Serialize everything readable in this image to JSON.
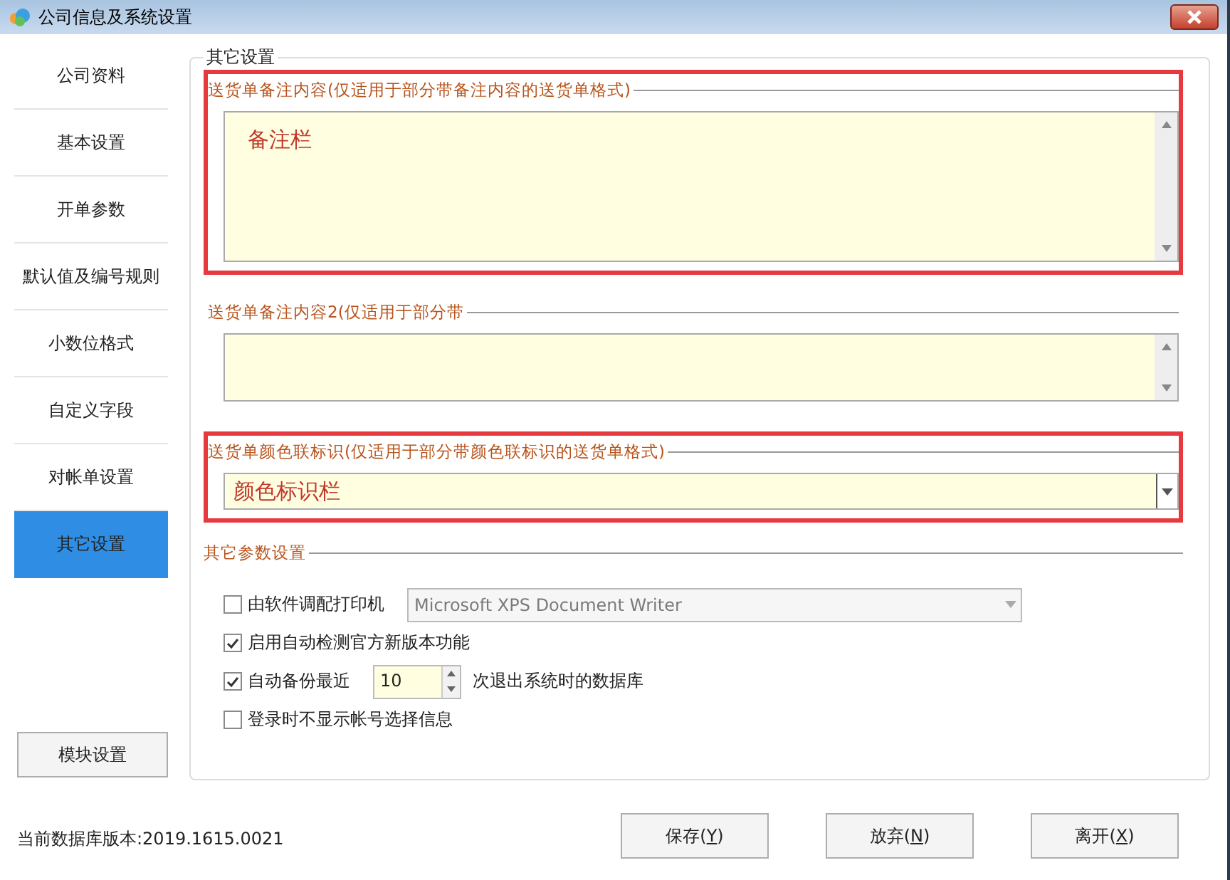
{
  "window": {
    "title": "公司信息及系统设置"
  },
  "sidebar": {
    "items": [
      {
        "label": "公司资料",
        "selected": false
      },
      {
        "label": "基本设置",
        "selected": false
      },
      {
        "label": "开单参数",
        "selected": false
      },
      {
        "label": "默认值及编号规则",
        "selected": false
      },
      {
        "label": "小数位格式",
        "selected": false
      },
      {
        "label": "自定义字段",
        "selected": false
      },
      {
        "label": "对帐单设置",
        "selected": false
      },
      {
        "label": "其它设置",
        "selected": true
      }
    ],
    "module_button": "模块设置"
  },
  "panel": {
    "title": "其它设置",
    "sections": [
      {
        "kind": "memo",
        "label": "送货单备注内容(仅适用于部分带备注内容的送货单格式)",
        "value": "备注栏",
        "highlighted": true
      },
      {
        "kind": "memo",
        "label": "送货单备注内容2(仅适用于部分带",
        "highlighted": false
      },
      {
        "kind": "combo",
        "label": "送货单颜色联标识(仅适用于部分带颜色联标识的送货单格式)",
        "value": "颜色标识栏",
        "highlighted": true
      }
    ],
    "params": {
      "label": "其它参数设置",
      "options": [
        {
          "kind": "printer",
          "label": "由软件调配打印机",
          "checked": false,
          "value": "Microsoft XPS Document Writer"
        },
        {
          "kind": "check",
          "label": "启用自动检测官方新版本功能",
          "checked": true
        },
        {
          "kind": "spin",
          "label": "自动备份最近",
          "checked": true,
          "value": "10",
          "suffix": "次退出系统时的数据库"
        },
        {
          "kind": "check",
          "label": "登录时不显示帐号选择信息",
          "checked": false
        }
      ]
    }
  },
  "status": "当前数据库版本:2019.1615.0021",
  "buttons": [
    {
      "label_before": "保存(",
      "access_key": "Y",
      "label_after": ")"
    },
    {
      "label_before": "放弃(",
      "access_key": "N",
      "label_after": ")"
    },
    {
      "label_before": "离开(",
      "access_key": "X",
      "label_after": ")"
    }
  ]
}
